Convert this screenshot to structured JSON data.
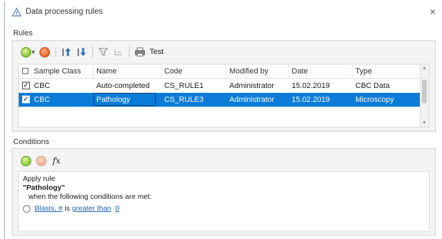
{
  "window": {
    "title": "Data processing rules",
    "close_glyph": "×",
    "title_icon": "warning-triangle-icon"
  },
  "rules": {
    "group_label": "Rules",
    "toolbar": {
      "add_icon": "add-green-circle-icon",
      "remove_icon": "remove-red-circle-icon",
      "move_up_icon": "move-up-icon",
      "move_down_icon": "move-down-icon",
      "filter_icon": "filter-icon",
      "import_icon": "import-icon",
      "print_icon": "print-icon",
      "test_label": "Test"
    },
    "columns": [
      "Sample Class",
      "Name",
      "Code",
      "Modified by",
      "Date",
      "Type"
    ],
    "rows": [
      {
        "checked": true,
        "selected": false,
        "sample_class": "CBC",
        "name": "Auto-completed",
        "code": "CS_RULE1",
        "modified_by": "Administrator",
        "date": "15.02.2019",
        "type": "CBC Data"
      },
      {
        "checked": true,
        "selected": true,
        "sample_class": "CBC",
        "name": "Pathology",
        "code": "CS_RULE3",
        "modified_by": "Administrator",
        "date": "15.02.2019",
        "type": "Microscopy"
      }
    ],
    "checkmark": "✓"
  },
  "conditions": {
    "group_label": "Conditions",
    "fx_label": "fx",
    "apply_text": "Apply rule",
    "rule_name": "\"Pathology\"",
    "when_text": "when the following conditions are met:",
    "condition": {
      "field": "Blasts, #",
      "verb": "is",
      "operator": "greater than",
      "value": "0"
    }
  },
  "colors": {
    "selection": "#0a7cd8",
    "link": "#1a5fb4",
    "add": "#8bc43a",
    "remove": "#e8632a"
  }
}
